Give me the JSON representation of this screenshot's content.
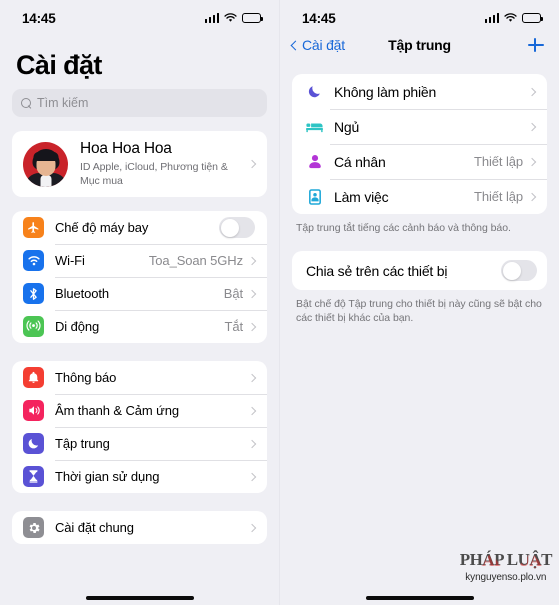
{
  "left": {
    "statusbar": {
      "time": "14:45",
      "signal_icon": "cellular-bars-icon",
      "wifi_icon": "wifi-icon",
      "battery_icon": "battery-icon"
    },
    "title": "Cài đặt",
    "search": {
      "placeholder": "Tìm kiếm",
      "icon": "search-icon"
    },
    "profile": {
      "name": "Hoa Hoa Hoa",
      "subtitle": "ID Apple, iCloud, Phương tiện & Mục mua",
      "avatar_icon": "avatar"
    },
    "group_connectivity": [
      {
        "label": "Chế độ máy bay",
        "icon": "airplane-icon",
        "color": "#f7821b",
        "control": "toggle",
        "toggle_on": false
      },
      {
        "label": "Wi-Fi",
        "icon": "wifi-icon",
        "color": "#1872ec",
        "value": "Toa_Soan 5GHz",
        "control": "chevron"
      },
      {
        "label": "Bluetooth",
        "icon": "bluetooth-icon",
        "color": "#1872ec",
        "value": "Bật",
        "control": "chevron"
      },
      {
        "label": "Di động",
        "icon": "cellular-antenna-icon",
        "color": "#4cc554",
        "value": "Tắt",
        "control": "chevron"
      }
    ],
    "group_alerts": [
      {
        "label": "Thông báo",
        "icon": "bell-icon",
        "color": "#f43e32",
        "control": "chevron"
      },
      {
        "label": "Âm thanh & Cảm ứng",
        "icon": "speaker-icon",
        "color": "#f4245e",
        "control": "chevron"
      },
      {
        "label": "Tập trung",
        "icon": "moon-icon",
        "color": "#5a52d5",
        "control": "chevron"
      },
      {
        "label": "Thời gian sử dụng",
        "icon": "hourglass-icon",
        "color": "#5a52d5",
        "control": "chevron"
      }
    ],
    "group_general": [
      {
        "label": "Cài đặt chung",
        "icon": "gear-icon",
        "color": "#8e8e93",
        "control": "chevron"
      }
    ]
  },
  "right": {
    "statusbar": {
      "time": "14:45",
      "signal_icon": "cellular-bars-icon",
      "wifi_icon": "wifi-icon",
      "battery_icon": "battery-icon"
    },
    "nav": {
      "back_label": "Cài đặt",
      "title": "Tập trung",
      "add_icon": "plus-icon"
    },
    "focus_modes": [
      {
        "label": "Không làm phiền",
        "icon": "moon-icon",
        "color": "#5a52d5",
        "value": ""
      },
      {
        "label": "Ngủ",
        "icon": "bed-icon",
        "color": "#2ec4c4",
        "value": ""
      },
      {
        "label": "Cá nhân",
        "icon": "person-icon",
        "color": "#b335d6",
        "value": "Thiết lập"
      },
      {
        "label": "Làm việc",
        "icon": "briefcase-icon",
        "color": "#1fa8d8",
        "value": "Thiết lập"
      }
    ],
    "focus_footnote": "Tập trung tắt tiếng các cảnh báo và thông báo.",
    "share": {
      "label": "Chia sẻ trên các thiết bị",
      "toggle_on": false,
      "footnote": "Bật chế độ Tập trung cho thiết bị này cũng sẽ bật cho các thiết bị khác của bạn."
    },
    "watermark": {
      "logo": "PHÁP LUẬT",
      "url": "kynguyenso.plo.vn"
    }
  }
}
